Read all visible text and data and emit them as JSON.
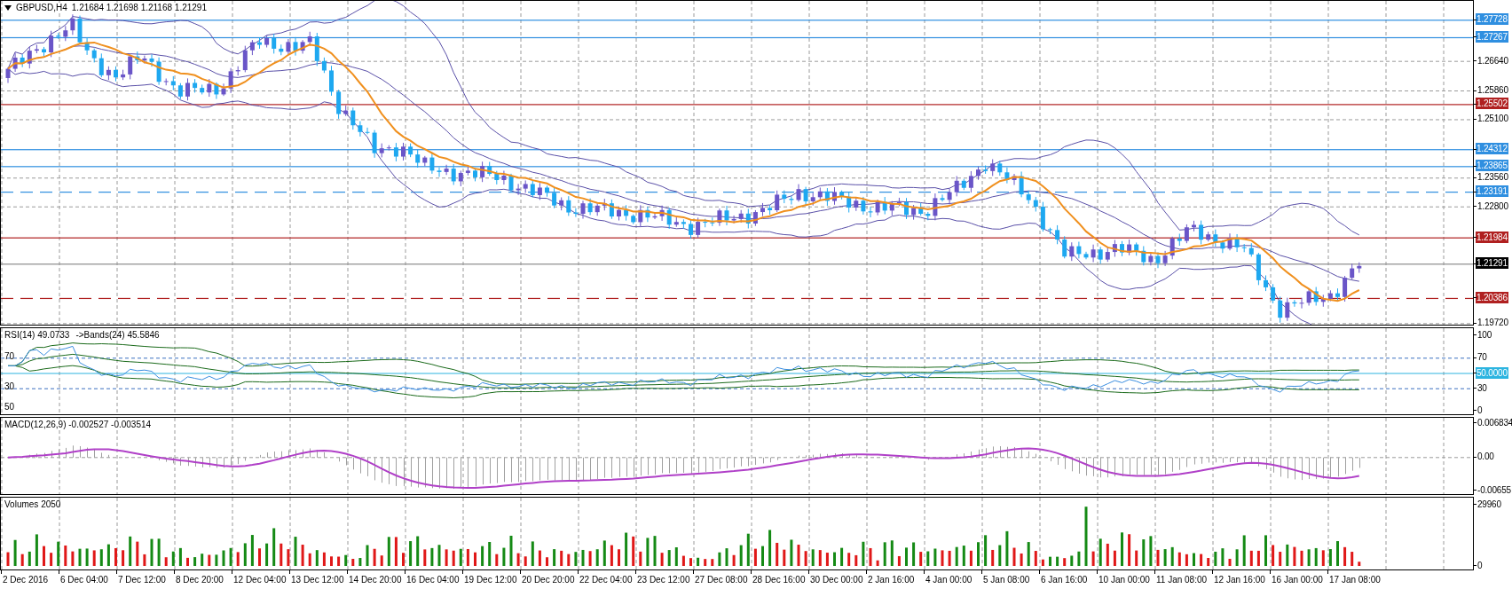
{
  "header": {
    "symbol": "GBPUSD,H4",
    "quote": "1.21684 1.21698 1.21168 1.21291"
  },
  "price_axis": {
    "ticks": [
      "1.26640",
      "1.25860",
      "1.25100",
      "1.23560",
      "1.22800",
      "1.19720"
    ]
  },
  "levels": [
    {
      "label": "1.27728",
      "kind": "level",
      "color": "#2f8fe0",
      "dashed": false
    },
    {
      "label": "1.27267",
      "kind": "level",
      "color": "#2f8fe0",
      "dashed": false
    },
    {
      "label": "1.25502",
      "kind": "level",
      "color": "#b02020",
      "dashed": false
    },
    {
      "label": "1.24312",
      "kind": "level",
      "color": "#2f8fe0",
      "dashed": false
    },
    {
      "label": "1.23865",
      "kind": "level",
      "color": "#2f8fe0",
      "dashed": false
    },
    {
      "label": "1.23191",
      "kind": "level",
      "color": "#2f8fe0",
      "dashed": true
    },
    {
      "label": "1.21984",
      "kind": "level",
      "color": "#b02020",
      "dashed": false
    },
    {
      "label": "1.21291",
      "kind": "bid",
      "color": "#000000",
      "dashed": false
    },
    {
      "label": "1.20386",
      "kind": "level",
      "color": "#b02020",
      "dashed": true
    }
  ],
  "rsi": {
    "title": "RSI(14) 49.0733",
    "bands_title": "->Bands(24) 45.5846",
    "axis": [
      "100",
      "70",
      "30",
      "0"
    ],
    "level_label": "50.0000",
    "left_labels": [
      "70",
      "30",
      "50"
    ]
  },
  "macd": {
    "title": "MACD(12,26,9) -0.002527 -0.003514",
    "axis": [
      "0.006834",
      "0.00",
      "-0.00655"
    ]
  },
  "volumes": {
    "title": "Volumes 2050",
    "axis": [
      "29960",
      "0"
    ]
  },
  "time_axis": {
    "labels": [
      "2 Dec 2016",
      "6 Dec 04:00",
      "7 Dec 12:00",
      "8 Dec 20:00",
      "12 Dec 04:00",
      "13 Dec 12:00",
      "14 Dec 20:00",
      "16 Dec 04:00",
      "19 Dec 12:00",
      "20 Dec 20:00",
      "22 Dec 04:00",
      "23 Dec 12:00",
      "27 Dec 08:00",
      "28 Dec 16:00",
      "30 Dec 00:00",
      "2 Jan 16:00",
      "4 Jan 00:00",
      "5 Jan 08:00",
      "6 Jan 16:00",
      "10 Jan 00:00",
      "11 Jan 08:00",
      "12 Jan 16:00",
      "16 Jan 00:00",
      "17 Jan 08:00"
    ]
  }
}
